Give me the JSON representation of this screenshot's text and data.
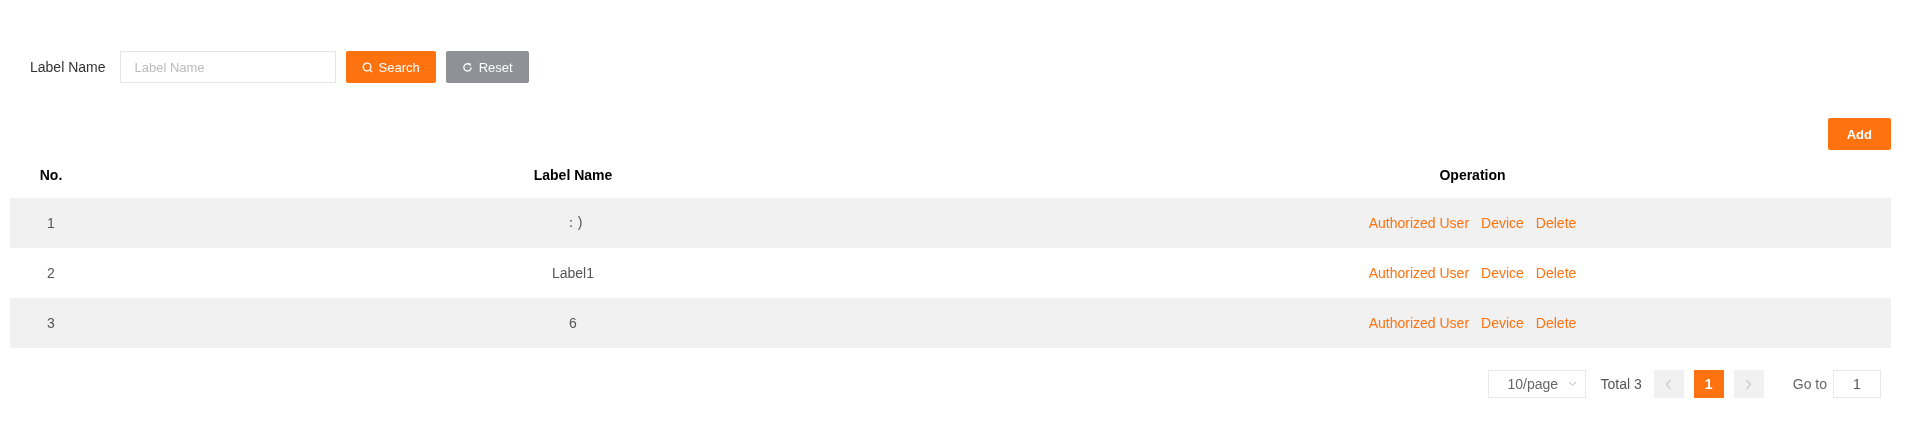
{
  "search_form": {
    "label": "Label Name",
    "placeholder": "Label Name",
    "search_button": "Search",
    "reset_button": "Reset"
  },
  "add_button": "Add",
  "table": {
    "columns": [
      "No.",
      "Label Name",
      "Operation"
    ],
    "rows": [
      {
        "no": "1",
        "label_name": "：)",
        "actions": [
          "Authorized User",
          "Device",
          "Delete"
        ]
      },
      {
        "no": "2",
        "label_name": "Label1",
        "actions": [
          "Authorized User",
          "Device",
          "Delete"
        ]
      },
      {
        "no": "3",
        "label_name": "6",
        "actions": [
          "Authorized User",
          "Device",
          "Delete"
        ]
      }
    ]
  },
  "pagination": {
    "page_size": "10/page",
    "total": "Total 3",
    "pages": [
      {
        "label": "1",
        "selected": true
      }
    ],
    "goto_label": "Go to",
    "goto_value": "1"
  }
}
